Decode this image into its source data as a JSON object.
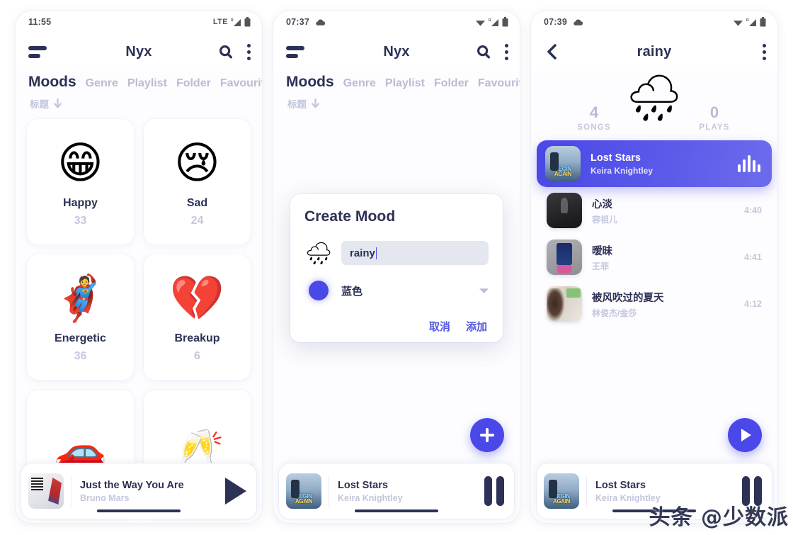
{
  "theme": {
    "accent": "#4a48e8",
    "ink": "#2c3155",
    "muted": "#c3c6dd",
    "panel_bg": "#fdfdff"
  },
  "panel1": {
    "status": {
      "time": "11:55",
      "network": "LTE",
      "signal_icon": "signal-icon",
      "battery_icon": "battery-icon"
    },
    "appbar": {
      "menu_icon": "hamburger-icon",
      "title": "Nyx",
      "search_icon": "search-icon",
      "more_icon": "kebab-menu-icon"
    },
    "tabs": [
      {
        "label": "Moods",
        "active": true
      },
      {
        "label": "Genre",
        "active": false
      },
      {
        "label": "Playlist",
        "active": false
      },
      {
        "label": "Folder",
        "active": false
      },
      {
        "label": "Favourite",
        "active": false
      }
    ],
    "sort": {
      "label": "标题",
      "icon": "arrow-down-icon"
    },
    "moods": [
      {
        "emoji": "😁",
        "name": "Happy",
        "count": "33"
      },
      {
        "emoji": "😢",
        "name": "Sad",
        "count": "24"
      },
      {
        "emoji": "🦸",
        "name": "Energetic",
        "count": "36"
      },
      {
        "emoji": "💔",
        "name": "Breakup",
        "count": "6"
      },
      {
        "emoji": "🚗",
        "name": "",
        "count": ""
      },
      {
        "emoji": "🥂",
        "name": "",
        "count": ""
      }
    ],
    "player": {
      "title": "Just the Way You Are",
      "artist": "Bruno Mars",
      "control_icon": "play-icon",
      "art": "art-bruno"
    }
  },
  "panel2": {
    "status": {
      "time": "07:37",
      "cloud_icon": "cloud-icon",
      "wifi_icon": "wifi-icon",
      "signal_icon": "signal-icon",
      "battery_icon": "battery-icon"
    },
    "appbar": {
      "menu_icon": "hamburger-icon",
      "title": "Nyx",
      "search_icon": "search-icon",
      "more_icon": "kebab-menu-icon"
    },
    "tabs": [
      {
        "label": "Moods",
        "active": true
      },
      {
        "label": "Genre",
        "active": false
      },
      {
        "label": "Playlist",
        "active": false
      },
      {
        "label": "Folder",
        "active": false
      },
      {
        "label": "Favourite",
        "active": false
      }
    ],
    "sort": {
      "label": "标题",
      "icon": "arrow-down-icon"
    },
    "dialog": {
      "title": "Create Mood",
      "emoji": "🌧",
      "name_value": "rainy",
      "name_placeholder": "",
      "color_swatch": "#4a48e8",
      "color_label": "蓝色",
      "dropdown_icon": "chevron-down-icon",
      "cancel_label": "取消",
      "confirm_label": "添加"
    },
    "fab": {
      "icon": "plus-icon"
    },
    "player": {
      "title": "Lost Stars",
      "artist": "Keira Knightley",
      "control_icon": "pause-icon",
      "art": "art-begin"
    }
  },
  "panel3": {
    "status": {
      "time": "07:39",
      "cloud_icon": "cloud-icon",
      "wifi_icon": "wifi-icon",
      "signal_icon": "signal-icon",
      "battery_icon": "battery-icon"
    },
    "appbar": {
      "back_icon": "back-arrow-icon",
      "title": "rainy",
      "more_icon": "kebab-menu-icon"
    },
    "hero_emoji": "🌧",
    "stats": [
      {
        "value": "4",
        "label": "SONGS"
      },
      {
        "value": "0",
        "label": "PLAYS"
      }
    ],
    "songs": [
      {
        "title": "Lost Stars",
        "artist": "Keira Knightley",
        "duration": "",
        "active": true,
        "art": "art-begin",
        "trailing_icon": "equalizer-icon"
      },
      {
        "title": "心淡",
        "artist": "容祖儿",
        "duration": "4:40",
        "active": false,
        "art": "art-dark",
        "trailing_icon": ""
      },
      {
        "title": "暧昧",
        "artist": "王菲",
        "duration": "4:41",
        "active": false,
        "art": "art-pink",
        "trailing_icon": ""
      },
      {
        "title": "被风吹过的夏天",
        "artist": "林俊杰/金莎",
        "duration": "4:12",
        "active": false,
        "art": "art-girl",
        "trailing_icon": ""
      }
    ],
    "fab": {
      "icon": "play-icon"
    },
    "player": {
      "title": "Lost Stars",
      "artist": "Keira Knightley",
      "control_icon": "pause-icon",
      "art": "art-begin"
    }
  },
  "watermark": {
    "text": "头条 @少数派"
  }
}
